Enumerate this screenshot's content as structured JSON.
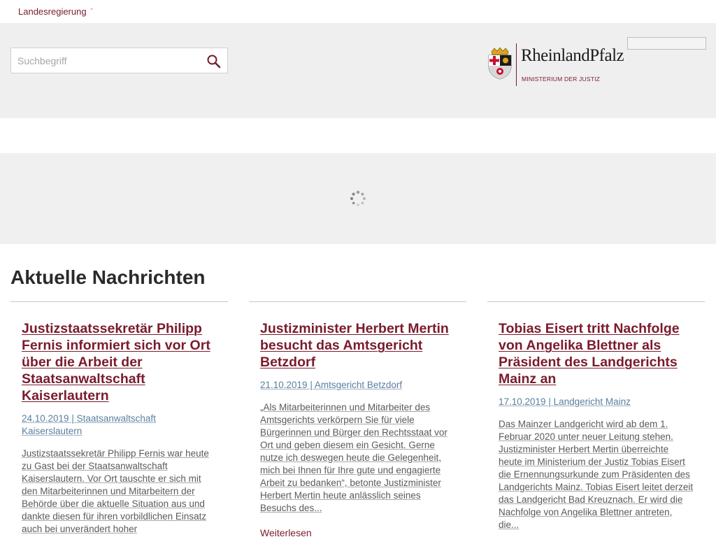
{
  "topbar": {
    "menu_label": "Landesregierung",
    "chevron_glyph": "ˇ"
  },
  "header": {
    "search_placeholder": "Suchbegriff",
    "search_icon": "search-icon",
    "logo": {
      "title": "RheinlandPfalz",
      "subtitle": "MINISTERIUM DER JUSTIZ"
    }
  },
  "news": {
    "heading": "Aktuelle Nachrichten",
    "items": [
      {
        "title": "Justizstaatssekretär Philipp Fernis informiert sich vor Ort über die Arbeit der Staatsanwaltschaft Kaiserlautern",
        "date": "24.10.2019",
        "separator": " | ",
        "source": "Staatsanwaltschaft Kaiserslautern",
        "teaser": "Justizstaatssekretär Philipp Fernis war heute zu Gast bei der Staatsanwaltschaft Kaiserslautern. Vor Ort tauschte er sich mit den Mitarbeiterinnen und Mitarbeitern der Behörde über die aktuelle Situation aus und dankte diesen für ihren vorbildlichen Einsatz auch bei unverändert hoher",
        "more": ""
      },
      {
        "title": "Justizminister Herbert Mertin besucht das Amtsgericht Betzdorf",
        "date": "21.10.2019",
        "separator": " | ",
        "source": "Amtsgericht Betzdorf",
        "teaser": "„Als Mitarbeiterinnen und Mitarbeiter des Amtsgerichts verkörpern Sie für viele Bürgerinnen und Bürger den Rechtsstaat vor Ort und geben diesem ein Gesicht. Gerne nutze ich deswegen heute die Gelegenheit, mich bei Ihnen für Ihre gute und engagierte Arbeit zu bedanken“, betonte Justizminister Herbert Mertin heute anlässlich seines Besuchs des...",
        "more": "Weiterlesen"
      },
      {
        "title": "Tobias Eisert tritt Nachfolge von Angelika Blettner als Präsident des Landgerichts Mainz an",
        "date": "17.10.2019",
        "separator": " | ",
        "source": "Landgericht Mainz",
        "teaser": "Das Mainzer Landgericht wird ab dem 1. Februar 2020 unter neuer Leitung stehen. Justizminister Herbert Mertin überreichte heute im Ministerium der Justiz Tobias Eisert die Ernennungsurkunde zum Präsidenten des Landgerichts Mainz. Tobias Eisert leitet derzeit das Landgericht Bad Kreuznach. Er wird die Nachfolge von Angelika Blettner antreten, die...",
        "more": ""
      }
    ]
  },
  "colors": {
    "brand": "#7a1b2c",
    "meta": "#5a7f9e",
    "header_bg": "#efefef"
  }
}
